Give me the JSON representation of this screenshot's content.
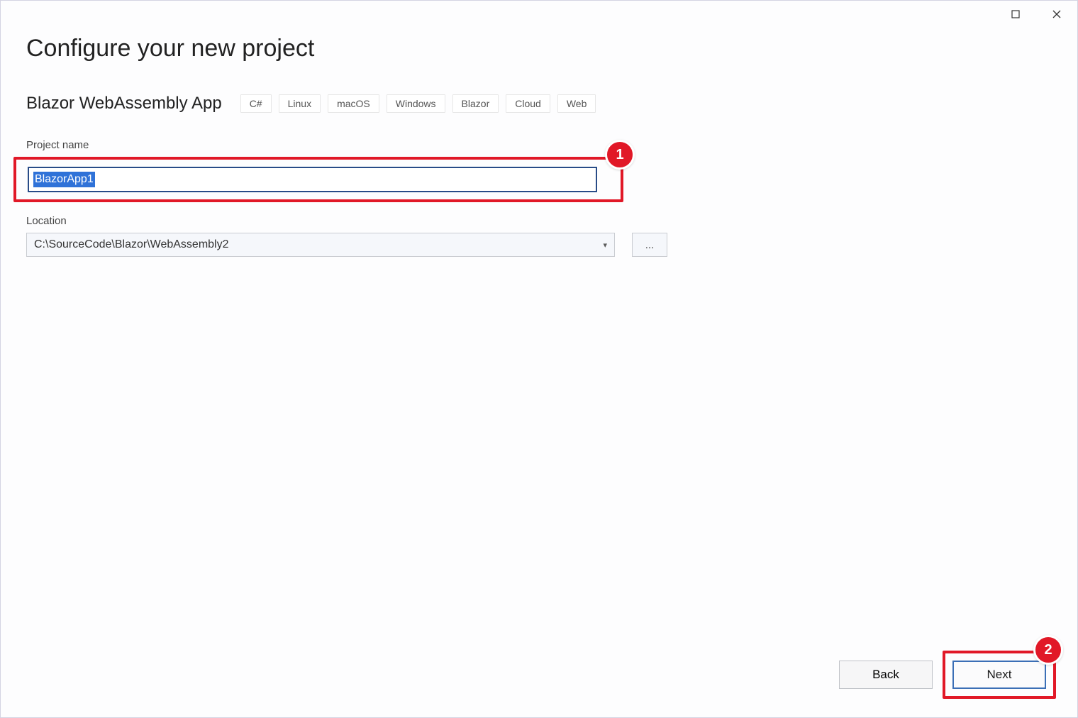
{
  "page_title": "Configure your new project",
  "template_name": "Blazor WebAssembly App",
  "tags": [
    "C#",
    "Linux",
    "macOS",
    "Windows",
    "Blazor",
    "Cloud",
    "Web"
  ],
  "project_name": {
    "label": "Project name",
    "value": "BlazorApp1"
  },
  "location": {
    "label": "Location",
    "value": "C:\\SourceCode\\Blazor\\WebAssembly2",
    "browse": "..."
  },
  "buttons": {
    "back": "Back",
    "next": "Next"
  },
  "callouts": {
    "one": "1",
    "two": "2"
  },
  "window_controls": {
    "maximize": "☐",
    "close": "✕"
  }
}
